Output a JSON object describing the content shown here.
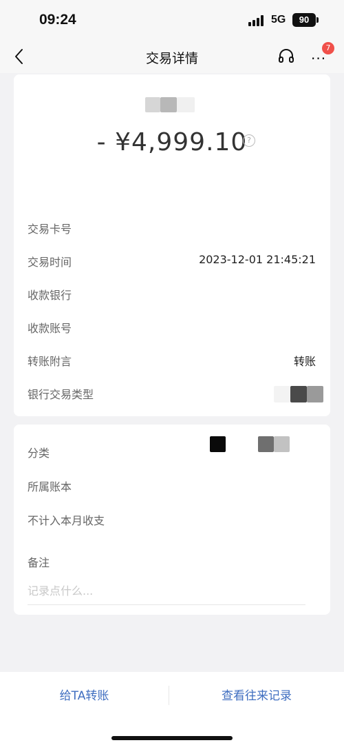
{
  "status_bar": {
    "time": "09:24",
    "network": "5G",
    "battery": "90"
  },
  "nav": {
    "title": "交易详情",
    "back_icon": "chevron-left-icon",
    "service_icon": "headset-icon",
    "more_icon": "more-dots-icon",
    "badge_count": "7"
  },
  "summary": {
    "amount": "- ¥4,999.10",
    "help_icon": "?"
  },
  "details": [
    {
      "label": "交易卡号",
      "value": ""
    },
    {
      "label": "交易时间",
      "value": "2023-12-01 21:45:21"
    },
    {
      "label": "收款银行",
      "value": ""
    },
    {
      "label": "收款账号",
      "value": ""
    },
    {
      "label": "转账附言",
      "value": "转账"
    },
    {
      "label": "银行交易类型",
      "value": ""
    }
  ],
  "extra": {
    "category_label": "分类",
    "book_label": "所属账本",
    "exclude_label": "不计入本月收支",
    "note_label": "备注",
    "note_placeholder": "记录点什么..."
  },
  "actions": {
    "transfer_label": "给TA转账",
    "history_label": "查看往来记录"
  },
  "colors": {
    "accent": "#3f6ec0",
    "badge": "#f0504a",
    "background": "#f2f2f4"
  }
}
